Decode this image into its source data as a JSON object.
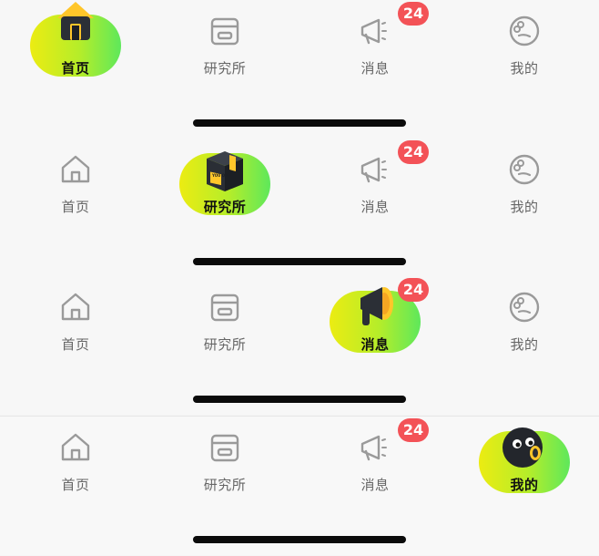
{
  "tabs": {
    "home": "首页",
    "lab": "研究所",
    "messages": "消息",
    "me": "我的"
  },
  "badge_count": "24",
  "box_icon_text": "YOU ONE",
  "colors": {
    "pill_start": "#ecec12",
    "pill_end": "#5ee85b",
    "badge": "#f35257",
    "icon_outline": "#9a9a9a"
  }
}
